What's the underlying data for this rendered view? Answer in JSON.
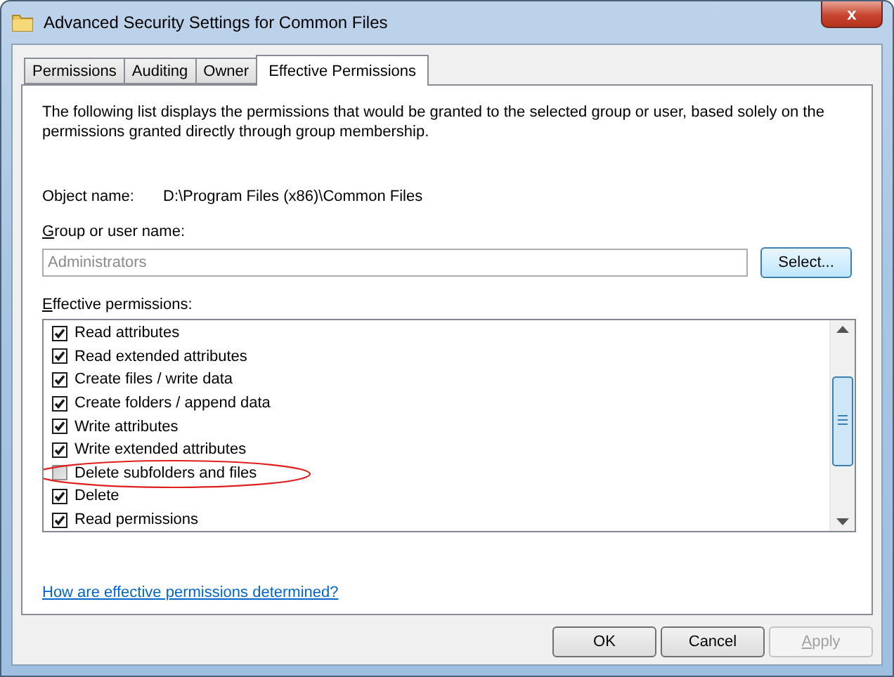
{
  "window": {
    "title": "Advanced Security Settings for Common Files",
    "close": "x"
  },
  "tabs": [
    {
      "label": "Permissions",
      "selected": false
    },
    {
      "label": "Auditing",
      "selected": false
    },
    {
      "label": "Owner",
      "selected": false
    },
    {
      "label": "Effective Permissions",
      "selected": true
    }
  ],
  "description": "The following list displays the permissions that would be granted to the selected group or user, based solely on the permissions granted directly through group membership.",
  "object_name": {
    "label": "Object name:",
    "value": "D:\\Program Files (x86)\\Common Files"
  },
  "group_field": {
    "label": "Group or user name:",
    "value": "Administrators",
    "disabled": true
  },
  "select_button": {
    "label": "Select...",
    "selected": true
  },
  "permissions_label": "Effective permissions:",
  "permissions": [
    {
      "label": "Read attributes",
      "checked": true,
      "circled": false
    },
    {
      "label": "Read extended attributes",
      "checked": true,
      "circled": false
    },
    {
      "label": "Create files / write data",
      "checked": true,
      "circled": false
    },
    {
      "label": "Create folders / append data",
      "checked": true,
      "circled": false
    },
    {
      "label": "Write attributes",
      "checked": true,
      "circled": false
    },
    {
      "label": "Write extended attributes",
      "checked": true,
      "circled": false
    },
    {
      "label": "Delete subfolders and files",
      "checked": false,
      "circled": true
    },
    {
      "label": "Delete",
      "checked": true,
      "circled": false
    },
    {
      "label": "Read permissions",
      "checked": true,
      "circled": false
    }
  ],
  "help_link": "How are effective permissions determined?",
  "buttons": [
    {
      "label": "OK",
      "disabled": false
    },
    {
      "label": "Cancel",
      "disabled": false
    },
    {
      "label": "Apply",
      "disabled": true
    }
  ]
}
